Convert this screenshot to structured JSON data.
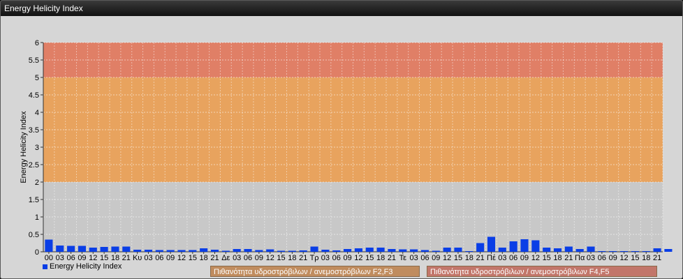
{
  "window": {
    "title": "Energy Helicity Index"
  },
  "legend": {
    "series_label": "Energy Helicity Index"
  },
  "bands": [
    {
      "label": "Πιθανότητα υδροστρόβιλων / ανεμοστρόβιλων F2,F3",
      "from": 2,
      "to": 5,
      "color": "#e8a35e"
    },
    {
      "label": "Πιθανότητα υδροστρόβιλων / ανεμοστρόβιλων F4,F5",
      "from": 5,
      "to": 6,
      "color": "#e07f66"
    }
  ],
  "colors": {
    "bar": "#0a3ee6",
    "band_low": "#c8c8c8",
    "band_mid": "#e8a35e",
    "band_high": "#e07f66",
    "band_mid_label": "#c08c5e",
    "band_high_label": "#c2766a"
  },
  "chart_data": {
    "type": "bar",
    "ylabel": "Energy Helicity Index",
    "ylim": [
      0,
      6
    ],
    "yticks": [
      "0",
      "0.5",
      "1",
      "1.5",
      "2",
      "2.5",
      "3",
      "3.5",
      "4",
      "4.5",
      "5",
      "5.5",
      "6"
    ],
    "categories": [
      "00",
      "03",
      "06",
      "09",
      "12",
      "15",
      "18",
      "21",
      "Κυ",
      "03",
      "06",
      "09",
      "12",
      "15",
      "18",
      "21",
      "Δε",
      "03",
      "06",
      "09",
      "12",
      "15",
      "18",
      "21",
      "Τρ",
      "03",
      "06",
      "09",
      "12",
      "15",
      "18",
      "21",
      "Τε",
      "03",
      "06",
      "09",
      "12",
      "15",
      "18",
      "21",
      "Πέ",
      "03",
      "06",
      "09",
      "12",
      "15",
      "18",
      "21",
      "Πα",
      "03",
      "06",
      "09",
      "12",
      "15",
      "18",
      "21"
    ],
    "values": [
      0.35,
      0.18,
      0.17,
      0.17,
      0.12,
      0.14,
      0.15,
      0.15,
      0.06,
      0.06,
      0.05,
      0.05,
      0.05,
      0.05,
      0.1,
      0.06,
      0.03,
      0.08,
      0.08,
      0.05,
      0.07,
      0.03,
      0.03,
      0.04,
      0.15,
      0.06,
      0.04,
      0.08,
      0.1,
      0.12,
      0.12,
      0.08,
      0.07,
      0.07,
      0.05,
      0.03,
      0.12,
      0.12,
      0.02,
      0.25,
      0.43,
      0.12,
      0.3,
      0.36,
      0.33,
      0.12,
      0.1,
      0.15,
      0.08,
      0.15,
      0.02,
      0.02,
      0.02,
      0.02,
      0.02,
      0.1,
      0.08
    ],
    "grid": true,
    "legend_position": "bottom-left"
  }
}
